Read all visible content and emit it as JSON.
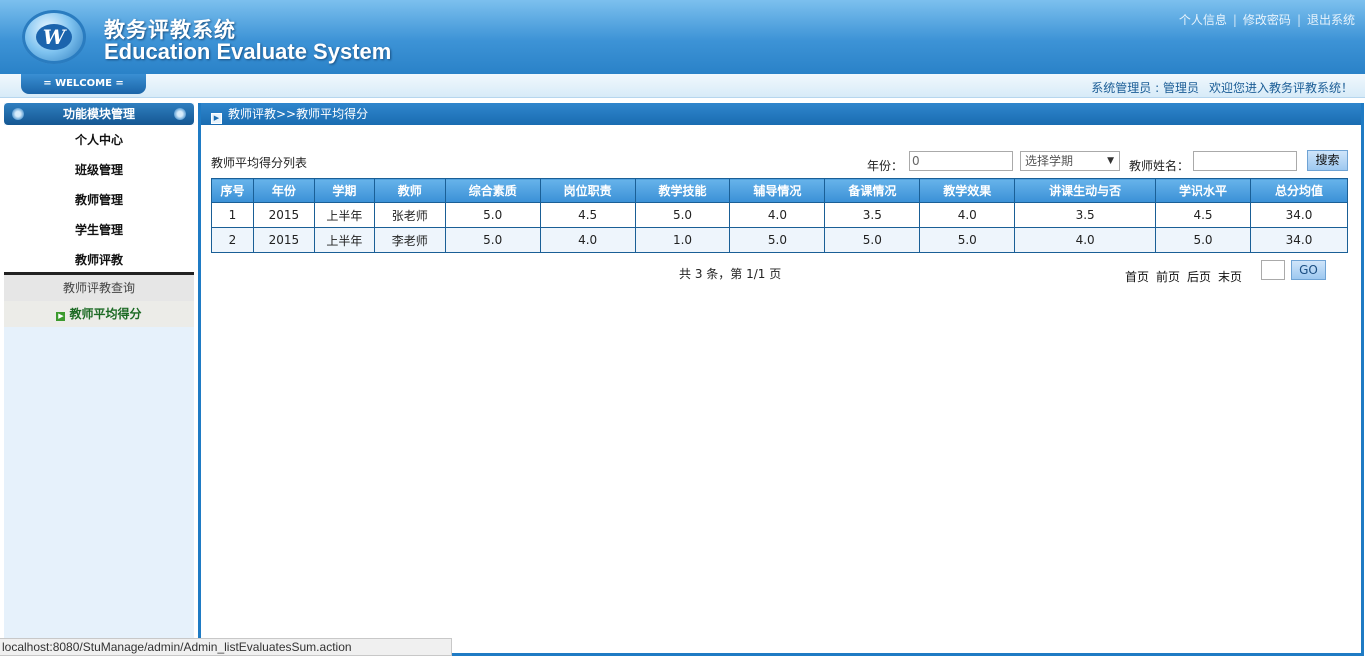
{
  "header": {
    "title_cn": "教务评教系统",
    "title_en": "Education Evaluate System",
    "links": [
      "个人信息",
      "修改密码",
      "退出系统"
    ],
    "separator": "|"
  },
  "welcome": {
    "tab": "= WELCOME =",
    "role": "系统管理员 : 管理员",
    "greeting": "欢迎您进入教务评教系统！"
  },
  "sidebar": {
    "heading": "功能模块管理",
    "items": [
      "个人中心",
      "班级管理",
      "教师管理",
      "学生管理",
      "教师评教"
    ],
    "sub_items": [
      "教师评教查询",
      "教师平均得分"
    ]
  },
  "breadcrumb": "教师评教>>教师平均得分",
  "filter": {
    "list_title": "教师平均得分列表",
    "year_label": "年份：",
    "year_value": "0",
    "semester_placeholder": "选择学期",
    "teacher_label": "教师姓名：",
    "teacher_value": "",
    "search_button": "搜索"
  },
  "table": {
    "headers": [
      "序号",
      "年份",
      "学期",
      "教师",
      "综合素质",
      "岗位职责",
      "教学技能",
      "辅导情况",
      "备课情况",
      "教学效果",
      "讲课生动与否",
      "学识水平",
      "总分均值"
    ],
    "rows": [
      [
        "1",
        "2015",
        "上半年",
        "张老师",
        "5.0",
        "4.5",
        "5.0",
        "4.0",
        "3.5",
        "4.0",
        "3.5",
        "4.5",
        "34.0"
      ],
      [
        "2",
        "2015",
        "上半年",
        "李老师",
        "5.0",
        "4.0",
        "1.0",
        "5.0",
        "5.0",
        "5.0",
        "4.0",
        "5.0",
        "34.0"
      ]
    ]
  },
  "pager": {
    "info": "共 3 条，第 1/1 页",
    "first": "首页",
    "prev": "前页",
    "next": "后页",
    "last": "末页",
    "go": "GO"
  },
  "statusbar": "localhost:8080/StuManage/admin/Admin_listEvaluatesSum.action"
}
